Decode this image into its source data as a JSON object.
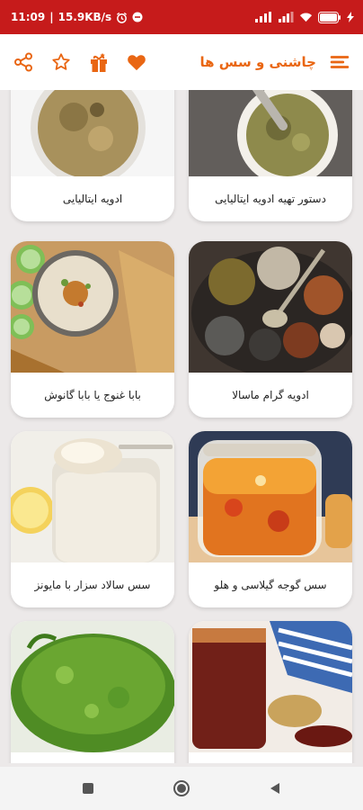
{
  "status": {
    "time": "11:09",
    "network_speed": "15.9KB/s",
    "battery": "55"
  },
  "header": {
    "title": "چاشنی و سس ها",
    "icons": [
      "share-icon",
      "star-icon",
      "gift-icon",
      "heart-icon",
      "menu-icon"
    ]
  },
  "colors": {
    "status_bar": "#c61b1b",
    "accent": "#e96613"
  },
  "cards": [
    {
      "label": "دستور تهیه ادویه ایتالیایی"
    },
    {
      "label": "ادویه ایتالیایی"
    },
    {
      "label": "ادویه گرام ماسالا"
    },
    {
      "label": "بابا غنوج یا بابا گانوش"
    },
    {
      "label": "سس گوجه گیلاسی و هلو"
    },
    {
      "label": "سس سالاد سزار با مایونز"
    },
    {
      "label": ""
    },
    {
      "label": ""
    }
  ]
}
